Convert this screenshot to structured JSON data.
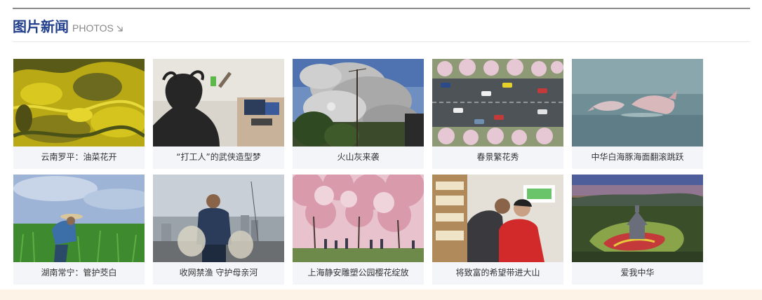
{
  "section": {
    "title": "图片新闻",
    "more_label": "PHOTOS"
  },
  "photos": [
    {
      "caption": "云南罗平：油菜花开",
      "image": "rapeseed-fields-aerial"
    },
    {
      "caption": "“打工人”的武侠造型梦",
      "image": "costumed-worker-at-desk"
    },
    {
      "caption": "火山灰来袭",
      "image": "volcanic-ash-cloud"
    },
    {
      "caption": "春景繁花秀",
      "image": "aerial-road-blossom-trees"
    },
    {
      "caption": "中华白海豚海面翻滚跳跃",
      "image": "white-dolphins-leaping"
    },
    {
      "caption": "湖南常宁：管护茭白",
      "image": "farmer-in-green-field"
    },
    {
      "caption": "收网禁渔 守护母亲河",
      "image": "fisherman-with-net"
    },
    {
      "caption": "上海静安雕塑公园樱花绽放",
      "image": "cherry-blossom-park"
    },
    {
      "caption": "将致富的希望带进大山",
      "image": "bookstore-shoppers"
    },
    {
      "caption": "爱我中华",
      "image": "aerial-village-temple"
    }
  ]
}
